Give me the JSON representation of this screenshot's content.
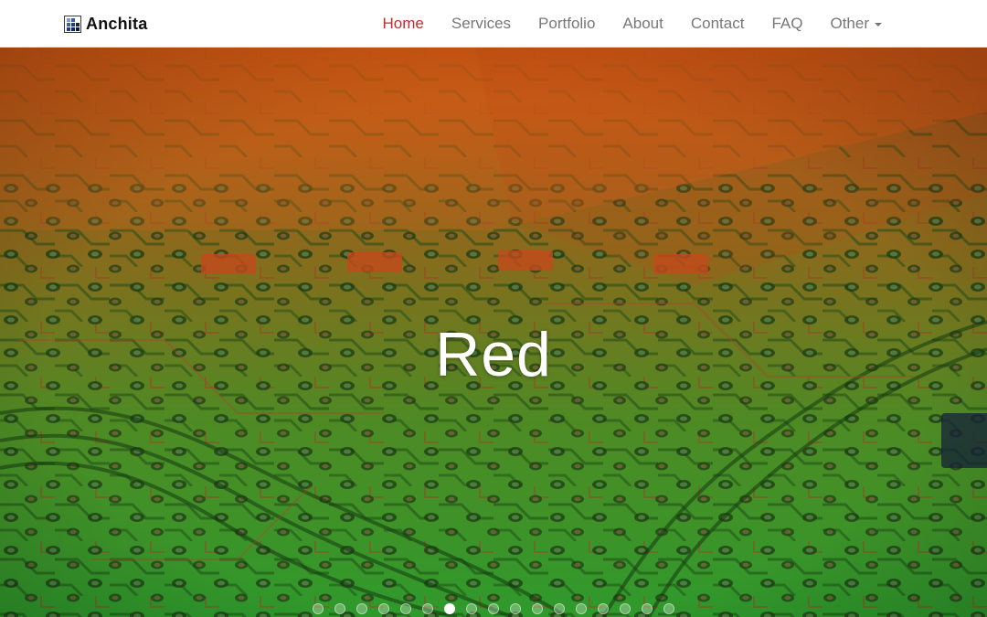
{
  "brand": {
    "name": "Anchita",
    "logo_icon": "pixel-grid-logo-icon"
  },
  "nav": {
    "items": [
      {
        "label": "Home",
        "active": true
      },
      {
        "label": "Services",
        "active": false
      },
      {
        "label": "Portfolio",
        "active": false
      },
      {
        "label": "About",
        "active": false
      },
      {
        "label": "Contact",
        "active": false
      },
      {
        "label": "FAQ",
        "active": false
      },
      {
        "label": "Other",
        "active": false,
        "dropdown": true
      }
    ]
  },
  "hero": {
    "slide_title": "Red",
    "slide_count": 17,
    "active_slide": 7,
    "background": "circuit-board-photo"
  },
  "colors": {
    "active_nav": "#c62c2c",
    "nav_text": "#777777",
    "overlay_orange": "#c85a14",
    "overlay_green": "#3fa52c"
  }
}
